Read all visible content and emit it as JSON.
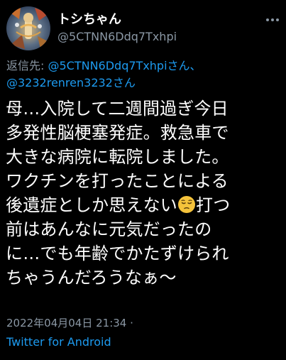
{
  "user": {
    "display_name": "トシちゃん",
    "handle": "@5CTNN6Ddq7Txhpi"
  },
  "reply": {
    "prefix": "返信先: ",
    "mention_1": "@5CTNN6Ddq7Txhpiさん、",
    "mention_2": "@3232renren3232さん"
  },
  "tweet": {
    "lines": [
      "母…入院して二週間過ぎ今日",
      "多発性脳梗塞発症。救急車で",
      "大きな病院に転院しました。",
      "ワクチンを打ったことによる",
      "後遺症としか思えない",
      "前はあんなに元気だったの",
      "に…でも年齢でかたずけられ",
      "ちゃうんだろうなぁ〜"
    ],
    "after_emoji": "打つ",
    "emoji_name": "pensive-face-emoji"
  },
  "meta": {
    "timestamp": "2022年04月04日 21:34 ·",
    "source": "Twitter for Android"
  },
  "icons": {
    "more": "more-options-icon",
    "avatar": "avatar"
  },
  "colors": {
    "background": "#000000",
    "text": "#ffffff",
    "secondary": "#8b98a5",
    "link": "#1d9bf0",
    "emoji": "#f5c33b"
  }
}
